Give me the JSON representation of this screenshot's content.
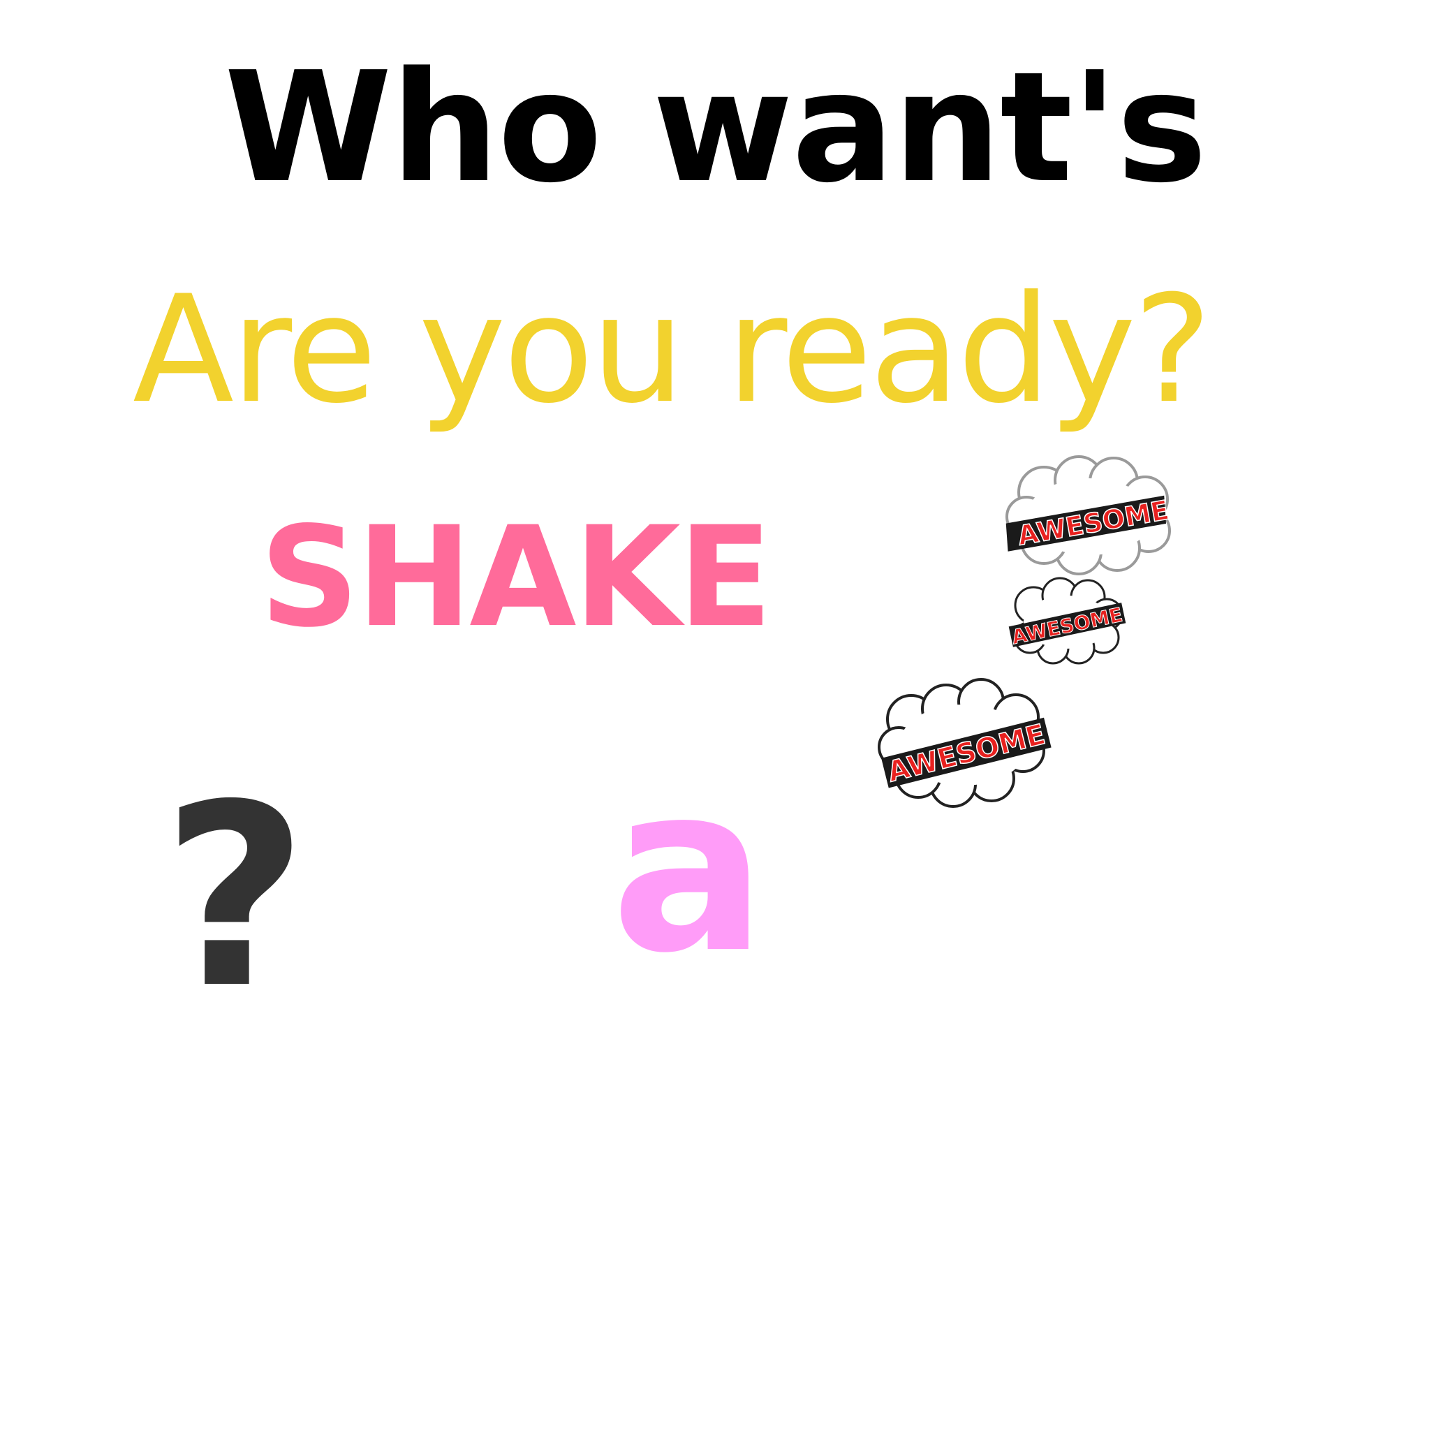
{
  "headline": "Who want's",
  "subline": "Are you ready?",
  "shake": "SHAKE",
  "question_mark": "?",
  "letter": "a",
  "stickers": [
    {
      "label": "AWESOME"
    },
    {
      "label": "AWESOME"
    },
    {
      "label": "AWESOME"
    }
  ],
  "colors": {
    "headline": "#000000",
    "subline": "#f2d22e",
    "shake": "#ff6b9a",
    "question_mark": "#333333",
    "letter": "#ff9cf8",
    "sticker_text": "#e8211f",
    "sticker_cloud": "#ffffff"
  }
}
